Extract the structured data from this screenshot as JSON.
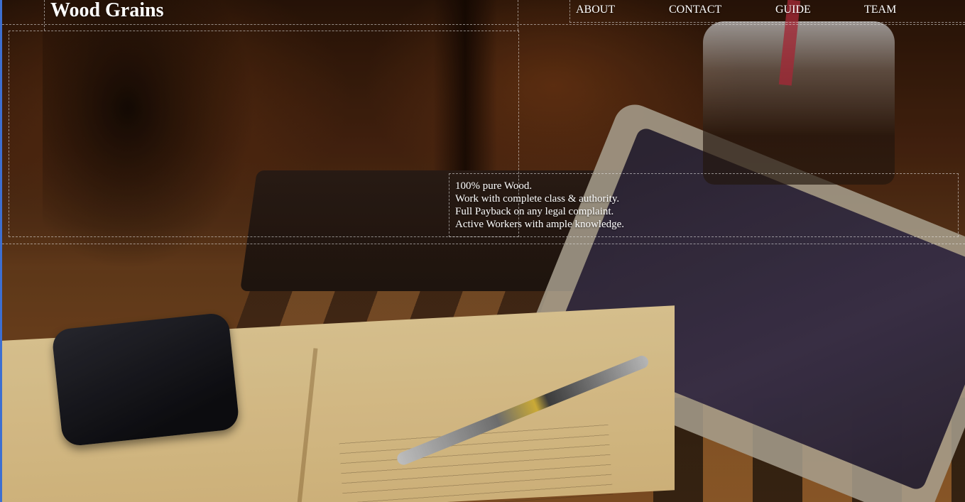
{
  "site": {
    "logo": "Wood Grains"
  },
  "nav": {
    "items": [
      {
        "label": "ABOUT"
      },
      {
        "label": "CONTACT"
      },
      {
        "label": "GUIDE"
      },
      {
        "label": "TEAM"
      }
    ]
  },
  "hero": {
    "features": [
      "100% pure Wood.",
      "Work with complete class & authority.",
      "Full Payback on any legal complaint.",
      "Active Workers with ample knowledge."
    ],
    "background_image": "desk-photo-with-notebook-phone-tablet-pen-and-iced-drink"
  },
  "colors": {
    "text": "#ffffff",
    "outline": "#ebebeb",
    "window_edge": "#3d6fd1"
  }
}
